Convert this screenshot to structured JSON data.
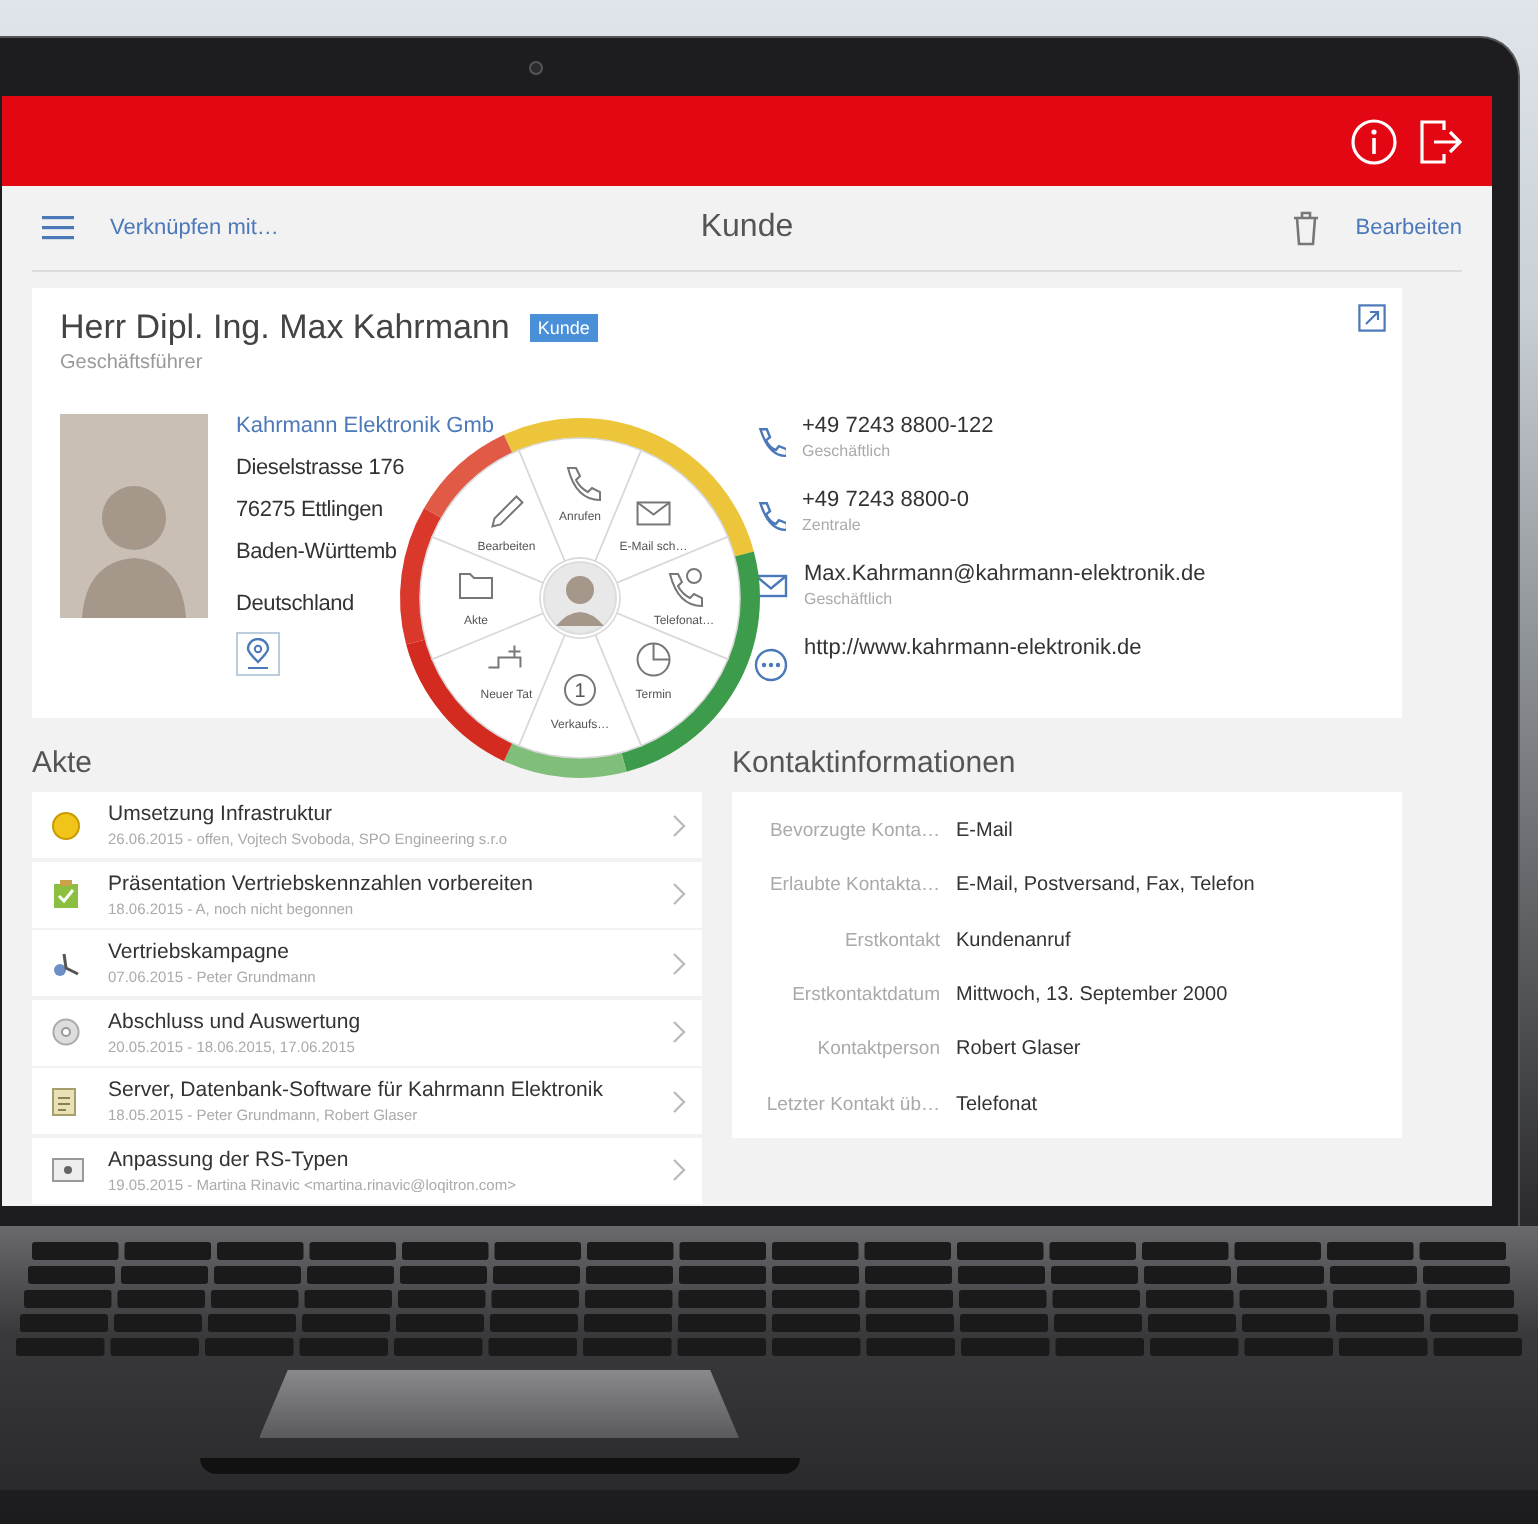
{
  "toolbar": {
    "link": "Verknüpfen mit…",
    "title": "Kunde",
    "edit": "Bearbeiten"
  },
  "customer": {
    "name": "Herr Dipl. Ing. Max Kahrmann",
    "badge": "Kunde",
    "role": "Geschäftsführer",
    "company": "Kahrmann Elektronik Gmb",
    "address": [
      "Dieselstrasse 176",
      "76275 Ettlingen",
      "Baden-Württemb"
    ],
    "country": "Deutschland",
    "contacts": [
      {
        "kind": "phone",
        "value": "+49 7243 8800-122",
        "label": "Geschäftlich"
      },
      {
        "kind": "phone",
        "value": "+49 7243 8800-0",
        "label": "Zentrale"
      },
      {
        "kind": "email",
        "value": "Max.Kahrmann@kahrmann-elektronik.de",
        "label": "Geschäftlich"
      },
      {
        "kind": "web",
        "value": "http://www.kahrmann-elektronik.de"
      }
    ]
  },
  "radial_menu": {
    "items": [
      {
        "kind": "call",
        "label": "Anrufen"
      },
      {
        "kind": "mail",
        "label": "E-Mail sch…"
      },
      {
        "kind": "phonelog",
        "label": "Telefonat…"
      },
      {
        "kind": "appointment",
        "label": "Termin"
      },
      {
        "kind": "sale",
        "label": "Verkaufs…",
        "icon_text": "1"
      },
      {
        "kind": "task",
        "label": "Neuer Tat"
      },
      {
        "kind": "folder",
        "label": "Akte"
      },
      {
        "kind": "edit",
        "label": "Bearbeiten"
      }
    ]
  },
  "akte": {
    "title": "Akte",
    "items": [
      {
        "kind": "coin",
        "title": "Umsetzung Infrastruktur",
        "subtitle": "26.06.2015 - offen, Vojtech Svoboda, SPO Engineering s.r.o"
      },
      {
        "kind": "check",
        "title": "Präsentation Vertriebskennzahlen vorbereiten",
        "subtitle": "18.06.2015 - A, noch nicht begonnen"
      },
      {
        "kind": "figure",
        "title": "Vertriebskampagne",
        "subtitle": "07.06.2015 - Peter Grundmann"
      },
      {
        "kind": "disc",
        "title": "Abschluss und Auswertung",
        "subtitle": "20.05.2015 - 18.06.2015, 17.06.2015"
      },
      {
        "kind": "doc",
        "title": "Server, Datenbank-Software für Kahrmann Elektronik",
        "subtitle": "18.05.2015 - Peter Grundmann, Robert Glaser"
      },
      {
        "kind": "card",
        "title": "Anpassung der RS-Typen",
        "subtitle": "19.05.2015 - Martina Rinavic <martina.rinavic@loqitron.com>"
      }
    ]
  },
  "contact_info": {
    "title": "Kontaktinformationen",
    "rows": [
      {
        "label": "Bevorzugte Konta…",
        "value": "E-Mail"
      },
      {
        "label": "Erlaubte Kontakta…",
        "value": "E-Mail, Postversand, Fax, Telefon"
      },
      {
        "label": "Erstkontakt",
        "value": "Kundenanruf"
      },
      {
        "label": "Erstkontaktdatum",
        "value": "Mittwoch, 13. September 2000"
      },
      {
        "label": "Kontaktperson",
        "value": "Robert Glaser"
      },
      {
        "label": "Letzter Kontakt üb…",
        "value": "Telefonat"
      }
    ]
  }
}
